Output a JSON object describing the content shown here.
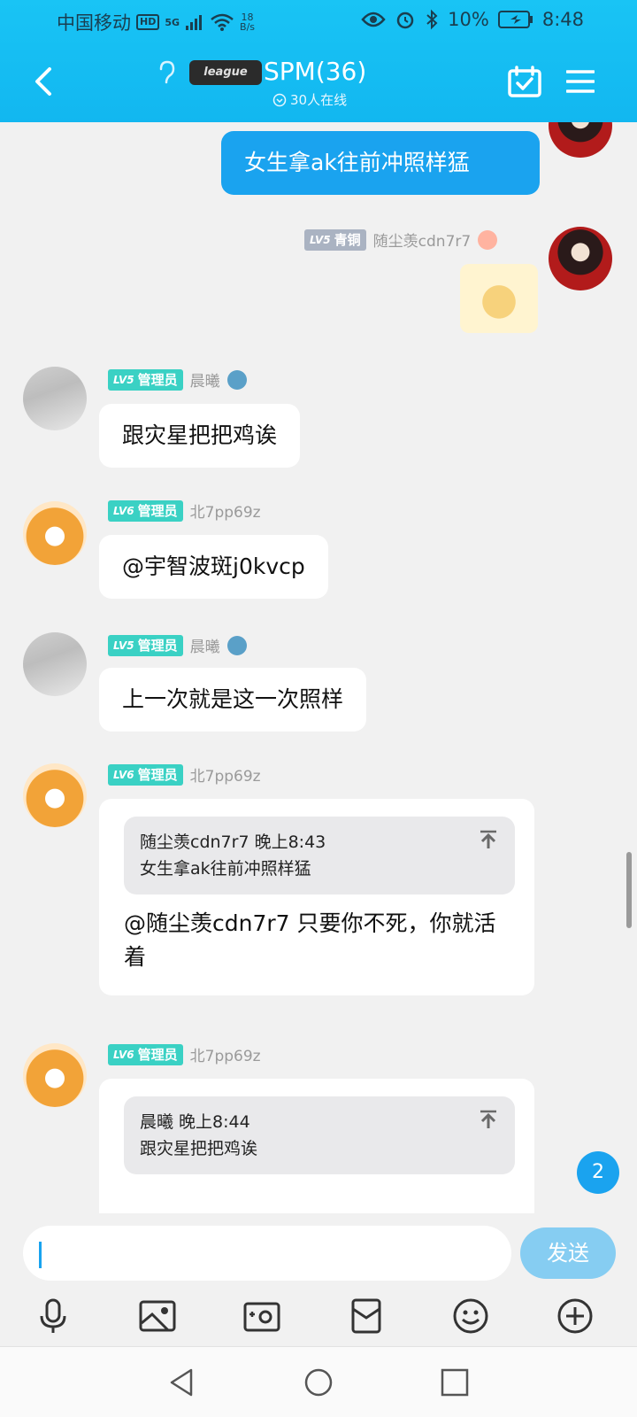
{
  "status": {
    "carrier": "中国移动",
    "hd": "HD",
    "signal": "5G",
    "net_speed_value": "18",
    "net_speed_unit": "B/s",
    "battery": "10%",
    "time": "8:48"
  },
  "header": {
    "logo_text": "league",
    "title": "SPM(36)",
    "online": "30人在线"
  },
  "messages": {
    "m1": {
      "text": "女生拿ak往前冲照样猛"
    },
    "m2": {
      "level": "LV5",
      "rank": "青铜",
      "name": "随尘羡cdn7r7"
    },
    "m3": {
      "level": "LV5",
      "role": "管理员",
      "name": "晨曦",
      "text": "跟灾星把把鸡诶"
    },
    "m4": {
      "level": "LV6",
      "role": "管理员",
      "name": "北7pp69z",
      "text": "@宇智波斑j0kvcp"
    },
    "m5": {
      "level": "LV5",
      "role": "管理员",
      "name": "晨曦",
      "text": "上一次就是这一次照样"
    },
    "m6": {
      "level": "LV6",
      "role": "管理员",
      "name": "北7pp69z",
      "quote_head": "随尘羡cdn7r7 晚上8:43",
      "quote_text": "女生拿ak往前冲照样猛",
      "text": "@随尘羡cdn7r7 只要你不死，你就活着"
    },
    "m7": {
      "level": "LV6",
      "role": "管理员",
      "name": "北7pp69z",
      "quote_head": "晨曦 晚上8:44",
      "quote_text": "跟灾星把把鸡诶"
    }
  },
  "unread_count": "2",
  "composer": {
    "send_label": "发送"
  },
  "colors": {
    "header": "#12b7f0",
    "bubble_mine": "#1aa3ef",
    "admin_badge": "#3ad1c4",
    "bronze_badge": "#aab3c2"
  },
  "icons": [
    "back-icon",
    "ear-icon",
    "online-icon",
    "calendar-check-icon",
    "menu-icon",
    "pin-top-icon",
    "microphone-icon",
    "image-icon",
    "camera-icon",
    "redpacket-icon",
    "emoji-icon",
    "plus-icon",
    "nav-back-icon",
    "nav-home-icon",
    "nav-recent-icon"
  ]
}
